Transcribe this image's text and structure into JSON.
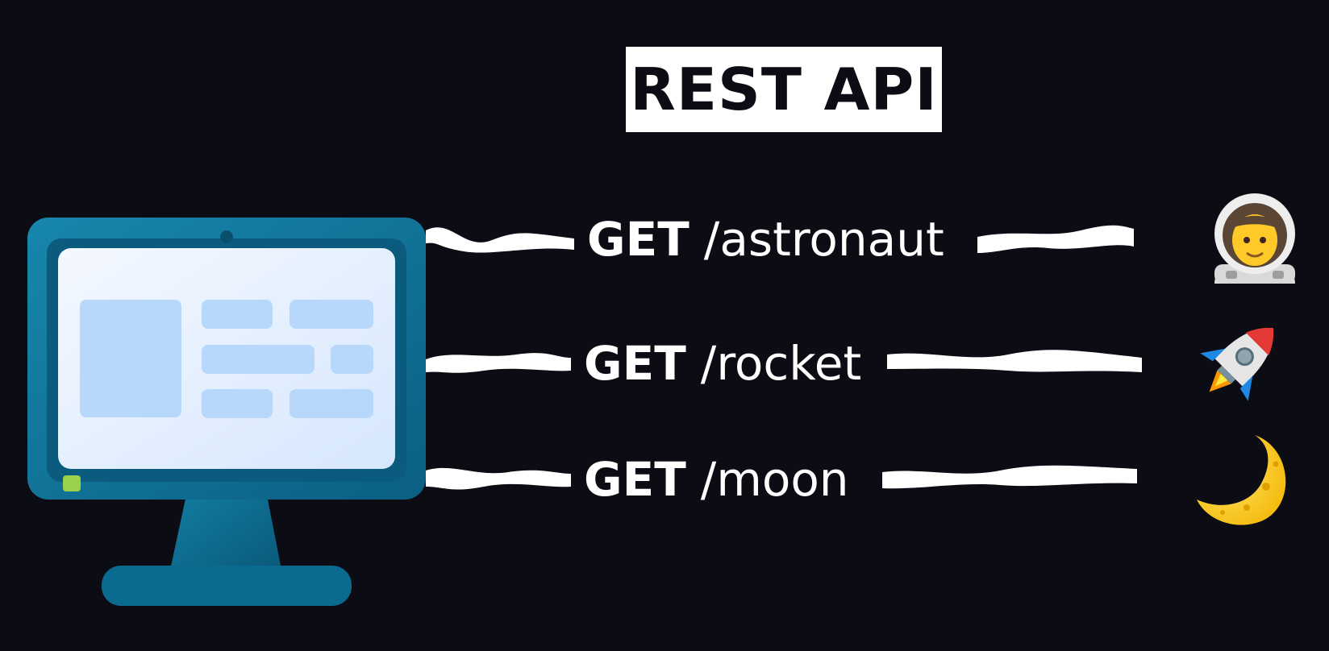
{
  "title": "REST API",
  "requests": [
    {
      "method": "GET",
      "path": "/astronaut",
      "resource_icon": "astronaut-icon"
    },
    {
      "method": "GET",
      "path": "/rocket",
      "resource_icon": "rocket-icon"
    },
    {
      "method": "GET",
      "path": "/moon",
      "resource_icon": "crescent-moon-icon"
    }
  ],
  "client_icon": "desktop-computer-icon",
  "colors": {
    "background": "#0c0c14",
    "title_box": "#ffffff",
    "title_text": "#0c0c14",
    "request_text": "#ffffff",
    "monitor_frame": "#0e6f93",
    "monitor_screen": "#e3efff",
    "screen_blocks": "#b7d7fb",
    "power_led": "#9bd14a"
  }
}
